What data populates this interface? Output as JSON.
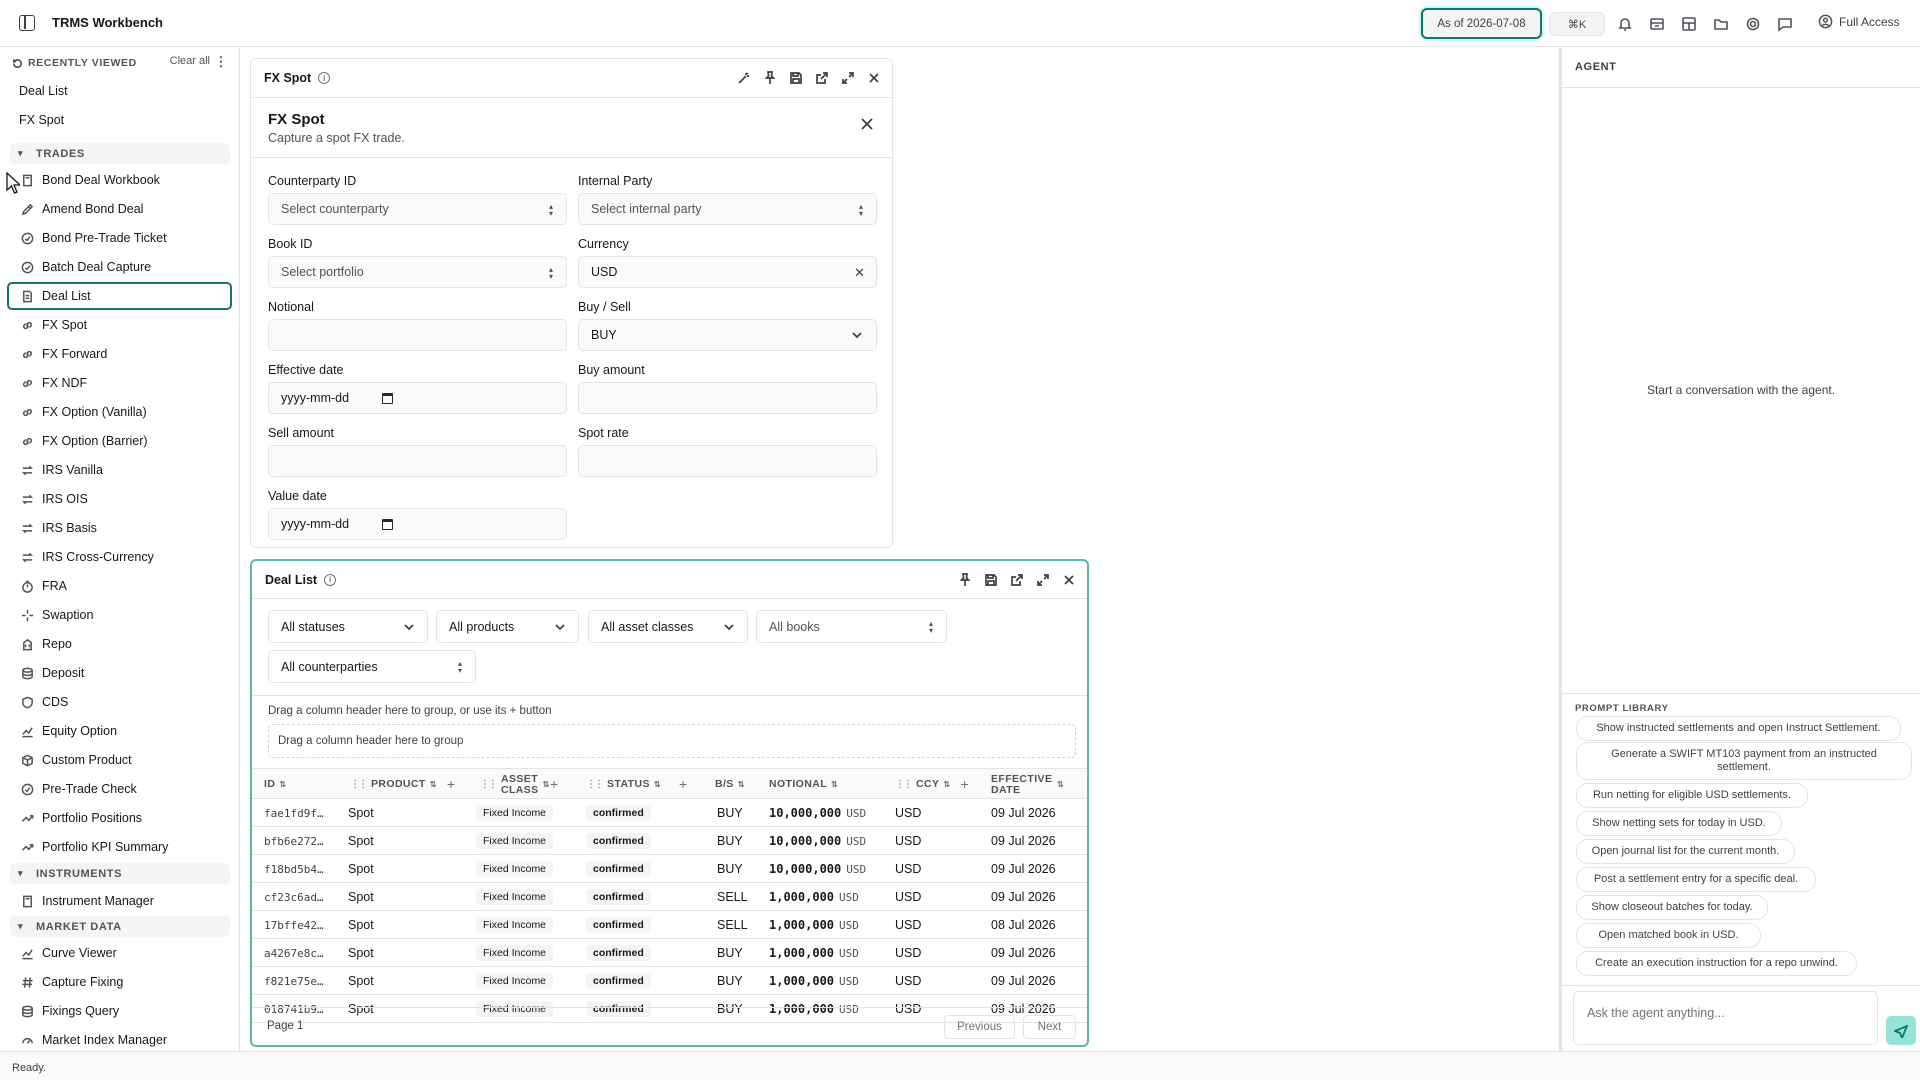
{
  "app": {
    "title": "TRMS Workbench",
    "as_of": "As of 2026-07-08",
    "shortcut": "⌘K",
    "access": "Full Access",
    "status": "Ready."
  },
  "sidebar": {
    "recent_title": "RECENTLY VIEWED",
    "clear_all": "Clear all",
    "recent": [
      "Deal List",
      "FX Spot"
    ],
    "sections": {
      "trades": "TRADES",
      "instruments": "INSTRUMENTS",
      "market_data": "MARKET DATA"
    },
    "trades": [
      "Bond Deal Workbook",
      "Amend Bond Deal",
      "Bond Pre-Trade Ticket",
      "Batch Deal Capture",
      "Deal List",
      "FX Spot",
      "FX Forward",
      "FX NDF",
      "FX Option (Vanilla)",
      "FX Option (Barrier)",
      "IRS Vanilla",
      "IRS OIS",
      "IRS Basis",
      "IRS Cross-Currency",
      "FRA",
      "Swaption",
      "Repo",
      "Deposit",
      "CDS",
      "Equity Option",
      "Custom Product",
      "Pre-Trade Check",
      "Portfolio Positions",
      "Portfolio KPI Summary"
    ],
    "instruments": [
      "Instrument Manager"
    ],
    "market_data": [
      "Curve Viewer",
      "Capture Fixing",
      "Fixings Query",
      "Market Index Manager"
    ],
    "active": "Deal List"
  },
  "fx_spot": {
    "panel_title": "FX Spot",
    "title": "FX Spot",
    "subtitle": "Capture a spot FX trade.",
    "fields": {
      "counterparty": {
        "label": "Counterparty ID",
        "placeholder": "Select counterparty"
      },
      "internal": {
        "label": "Internal Party",
        "placeholder": "Select internal party"
      },
      "book": {
        "label": "Book ID",
        "placeholder": "Select portfolio"
      },
      "currency": {
        "label": "Currency",
        "value": "USD"
      },
      "notional": {
        "label": "Notional",
        "value": ""
      },
      "buysell": {
        "label": "Buy / Sell",
        "value": "BUY"
      },
      "effective": {
        "label": "Effective date",
        "placeholder": "yyyy-mm-dd"
      },
      "buy_amount": {
        "label": "Buy amount",
        "value": ""
      },
      "sell_amount": {
        "label": "Sell amount",
        "value": ""
      },
      "spot_rate": {
        "label": "Spot rate",
        "value": ""
      },
      "value_date": {
        "label": "Value date",
        "placeholder": "yyyy-mm-dd"
      }
    }
  },
  "deal_list": {
    "panel_title": "Deal List",
    "filters": [
      "All statuses",
      "All products",
      "All asset classes",
      "All books",
      "All counterparties"
    ],
    "group_hint": "Drag a column header here to group, or use its + button",
    "group_zone": "Drag a column header here to group",
    "columns": [
      "ID",
      "PRODUCT",
      "ASSET CLASS",
      "STATUS",
      "B/S",
      "NOTIONAL",
      "CCY",
      "EFFECTIVE DATE"
    ],
    "rows": [
      {
        "id": "fae1fd9f…",
        "product": "Spot",
        "asset": "Fixed Income",
        "status": "confirmed",
        "bs": "BUY",
        "notional": "10,000,000",
        "nccy": "USD",
        "ccy": "USD",
        "date": "09 Jul 2026"
      },
      {
        "id": "bfb6e272…",
        "product": "Spot",
        "asset": "Fixed Income",
        "status": "confirmed",
        "bs": "BUY",
        "notional": "10,000,000",
        "nccy": "USD",
        "ccy": "USD",
        "date": "09 Jul 2026"
      },
      {
        "id": "f18bd5b4…",
        "product": "Spot",
        "asset": "Fixed Income",
        "status": "confirmed",
        "bs": "BUY",
        "notional": "10,000,000",
        "nccy": "USD",
        "ccy": "USD",
        "date": "09 Jul 2026"
      },
      {
        "id": "cf23c6ad…",
        "product": "Spot",
        "asset": "Fixed Income",
        "status": "confirmed",
        "bs": "SELL",
        "notional": "1,000,000",
        "nccy": "USD",
        "ccy": "USD",
        "date": "09 Jul 2026"
      },
      {
        "id": "17bffe42…",
        "product": "Spot",
        "asset": "Fixed Income",
        "status": "confirmed",
        "bs": "SELL",
        "notional": "1,000,000",
        "nccy": "USD",
        "ccy": "USD",
        "date": "08 Jul 2026"
      },
      {
        "id": "a4267e8c…",
        "product": "Spot",
        "asset": "Fixed Income",
        "status": "confirmed",
        "bs": "BUY",
        "notional": "1,000,000",
        "nccy": "USD",
        "ccy": "USD",
        "date": "09 Jul 2026"
      },
      {
        "id": "f821e75e…",
        "product": "Spot",
        "asset": "Fixed Income",
        "status": "confirmed",
        "bs": "BUY",
        "notional": "1,000,000",
        "nccy": "USD",
        "ccy": "USD",
        "date": "09 Jul 2026"
      },
      {
        "id": "018741b9…",
        "product": "Spot",
        "asset": "Fixed Income",
        "status": "confirmed",
        "bs": "BUY",
        "notional": "1,000,000",
        "nccy": "USD",
        "ccy": "USD",
        "date": "09 Jul 2026"
      }
    ],
    "page": "Page 1",
    "prev": "Previous",
    "next": "Next"
  },
  "agent": {
    "title": "AGENT",
    "empty": "Start a conversation with the agent.",
    "library_title": "PROMPT LIBRARY",
    "prompts": [
      "Show instructed settlements and open Instruct Settlement.",
      "Generate a SWIFT MT103 payment from an instructed settlement.",
      "Run netting for eligible USD settlements.",
      "Show netting sets for today in USD.",
      "Open journal list for the current month.",
      "Post a settlement entry for a specific deal.",
      "Show closeout batches for today.",
      "Open matched book in USD.",
      "Create an execution instruction for a repo unwind."
    ],
    "input_placeholder": "Ask the agent anything..."
  },
  "colors": {
    "accent": "#0f766e",
    "send_bg": "#99e2d6"
  }
}
